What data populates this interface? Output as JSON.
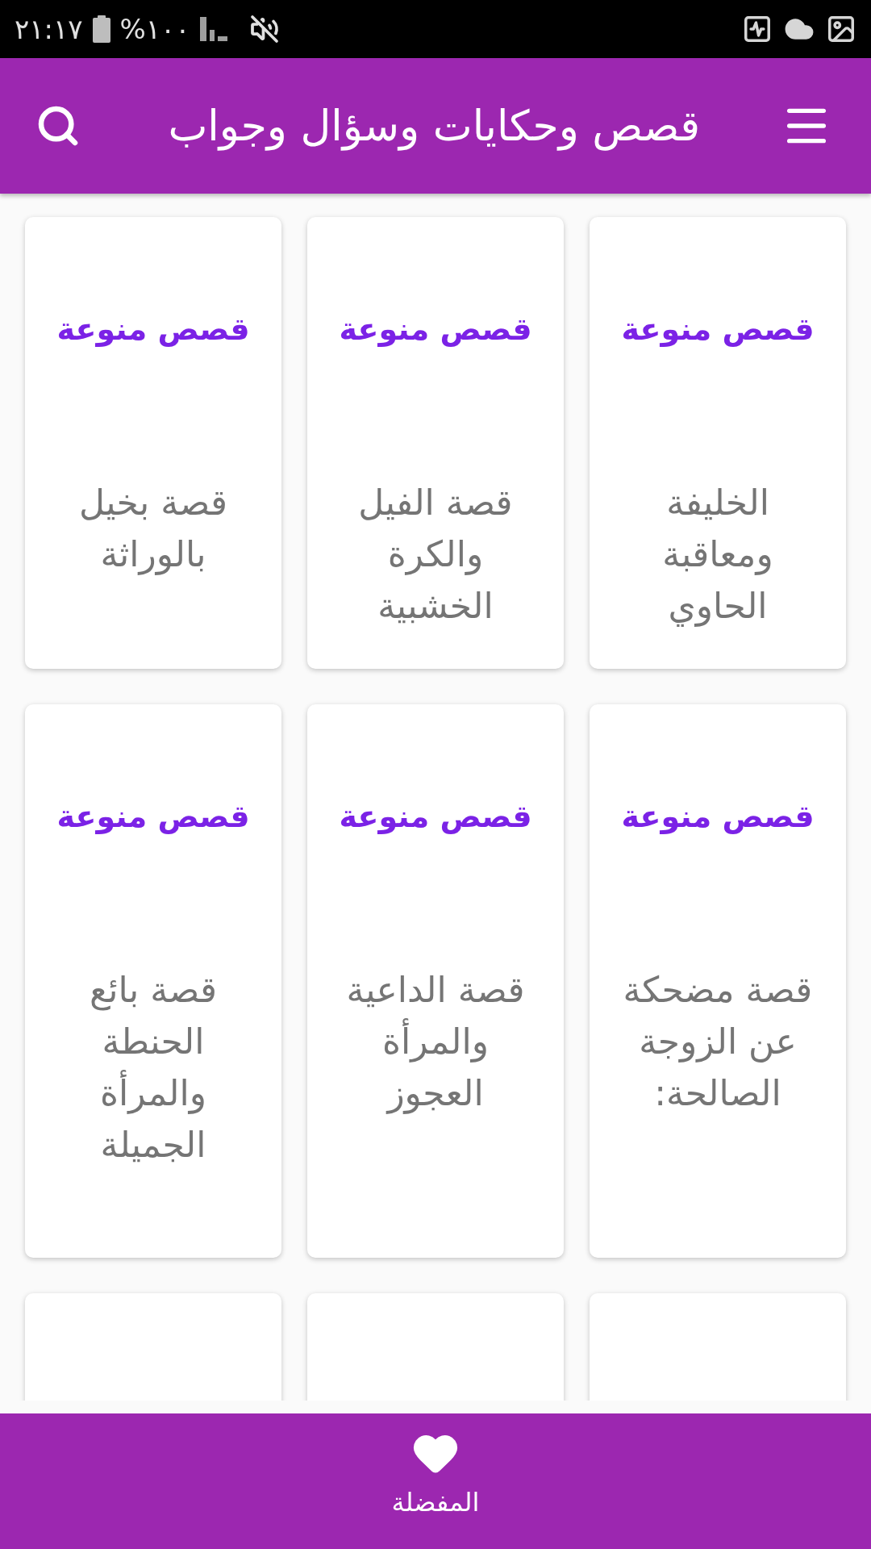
{
  "status_bar": {
    "time": "٢١:١٧",
    "battery": "%١٠٠"
  },
  "app_bar": {
    "title": "قصص وحكايات وسؤال وجواب"
  },
  "stories": [
    {
      "kind": "card",
      "image_text": "قصص منوعة",
      "title": "الخليفة ومعاقبة الحاوي"
    },
    {
      "kind": "card",
      "image_text": "قصص منوعة",
      "title": "قصة الفيل والكرة الخشبية"
    },
    {
      "kind": "card",
      "image_text": "قصص منوعة",
      "title": "قصة بخيل بالوراثة"
    },
    {
      "kind": "card",
      "image_text": "قصص منوعة",
      "title": "قصة مضحكة عن الزوجة الصالحة:"
    },
    {
      "kind": "card",
      "image_text": "قصص منوعة",
      "title": "قصة الداعية والمرأة العجوز"
    },
    {
      "kind": "card",
      "image_text": "قصص منوعة",
      "title": "قصة بائع الحنطة والمرأة الجميلة"
    },
    {
      "kind": "partial"
    },
    {
      "kind": "partial"
    },
    {
      "kind": "partial"
    }
  ],
  "bottom_nav": [
    {
      "label": "المفضلة"
    }
  ]
}
